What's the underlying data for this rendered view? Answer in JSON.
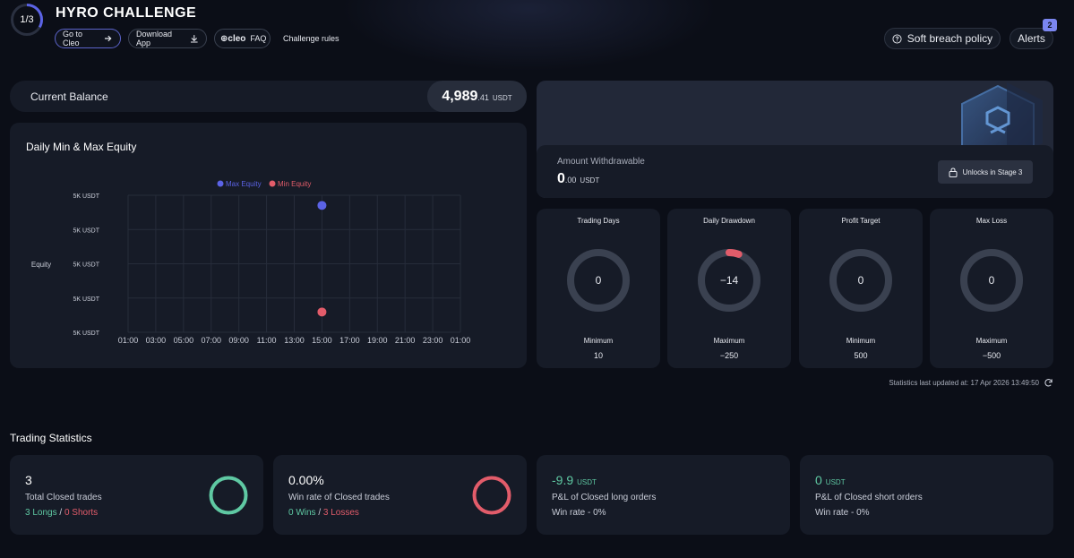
{
  "header": {
    "stage": "1/3",
    "title": "HYRO CHALLENGE",
    "go_to_cleo": "Go to Cleo",
    "download_app": "Download App",
    "cleo_logo": "cleo",
    "faq": "FAQ",
    "challenge_rules": "Challenge rules",
    "soft_breach_policy": "Soft breach policy",
    "alerts": "Alerts",
    "alerts_count": "2"
  },
  "balance": {
    "label": "Current Balance",
    "int": "4,989",
    "dec": ".41",
    "unit": "USDT"
  },
  "equity_chart": {
    "title": "Daily Min & Max Equity",
    "legend_max": "Max Equity",
    "legend_min": "Min Equity",
    "ylabel": "Equity",
    "y_ticks": [
      "5K USDT",
      "5K USDT",
      "5K USDT",
      "5K USDT",
      "5K USDT"
    ],
    "x_ticks": [
      "01:00",
      "03:00",
      "05:00",
      "07:00",
      "09:00",
      "11:00",
      "13:00",
      "15:00",
      "17:00",
      "19:00",
      "21:00",
      "23:00",
      "01:00"
    ]
  },
  "chart_data": {
    "type": "scatter",
    "title": "Daily Min & Max Equity",
    "xlabel": "",
    "ylabel": "Equity",
    "x_ticks": [
      "01:00",
      "03:00",
      "05:00",
      "07:00",
      "09:00",
      "11:00",
      "13:00",
      "15:00",
      "17:00",
      "19:00",
      "21:00",
      "23:00",
      "01:00"
    ],
    "y_ticks": [
      "5K USDT",
      "5K USDT",
      "5K USDT",
      "5K USDT",
      "5K USDT"
    ],
    "series": [
      {
        "name": "Max Equity",
        "color": "#5b63e6",
        "points": [
          {
            "x": "15:00",
            "y": 5010
          }
        ]
      },
      {
        "name": "Min Equity",
        "color": "#e25c6a",
        "points": [
          {
            "x": "15:00",
            "y": 4989
          }
        ]
      }
    ],
    "legend": "top-center",
    "grid": true
  },
  "withdraw": {
    "label": "Amount Withdrawable",
    "int": "0",
    "dec": ".00",
    "unit": "USDT",
    "unlock_label": "Unlocks in Stage 3"
  },
  "stats": [
    {
      "title": "Trading Days",
      "value": "0",
      "sub": "Minimum",
      "limit": "10",
      "progress": 0
    },
    {
      "title": "Daily Drawdown",
      "value": "−14",
      "sub": "Maximum",
      "limit": "−250",
      "progress": 0.056
    },
    {
      "title": "Profit Target",
      "value": "0",
      "sub": "Minimum",
      "limit": "500",
      "progress": 0
    },
    {
      "title": "Max Loss",
      "value": "0",
      "sub": "Maximum",
      "limit": "−500",
      "progress": 0
    }
  ],
  "updated": "Statistics last updated at: 17 Apr 2026 13:49:50",
  "trading_statistics": {
    "title": "Trading Statistics",
    "cards": [
      {
        "value": "3",
        "label": "Total Closed trades",
        "foot_a": "3 Longs",
        "sep": " / ",
        "foot_b": "0 Shorts"
      },
      {
        "value": "0.00%",
        "label": "Win rate of Closed trades",
        "foot_a": "0 Wins",
        "sep": " / ",
        "foot_b": "3 Losses"
      },
      {
        "value": "-9.9",
        "unit": "USDT",
        "label": "P&L of Closed long orders",
        "foot": "Win rate - 0%"
      },
      {
        "value": "0",
        "unit": "USDT",
        "label": "P&L of Closed short orders",
        "foot": "Win rate - 0%"
      }
    ]
  },
  "colors": {
    "accent": "#5b63e6",
    "green": "#5fc9a3",
    "red": "#e25c6a"
  }
}
